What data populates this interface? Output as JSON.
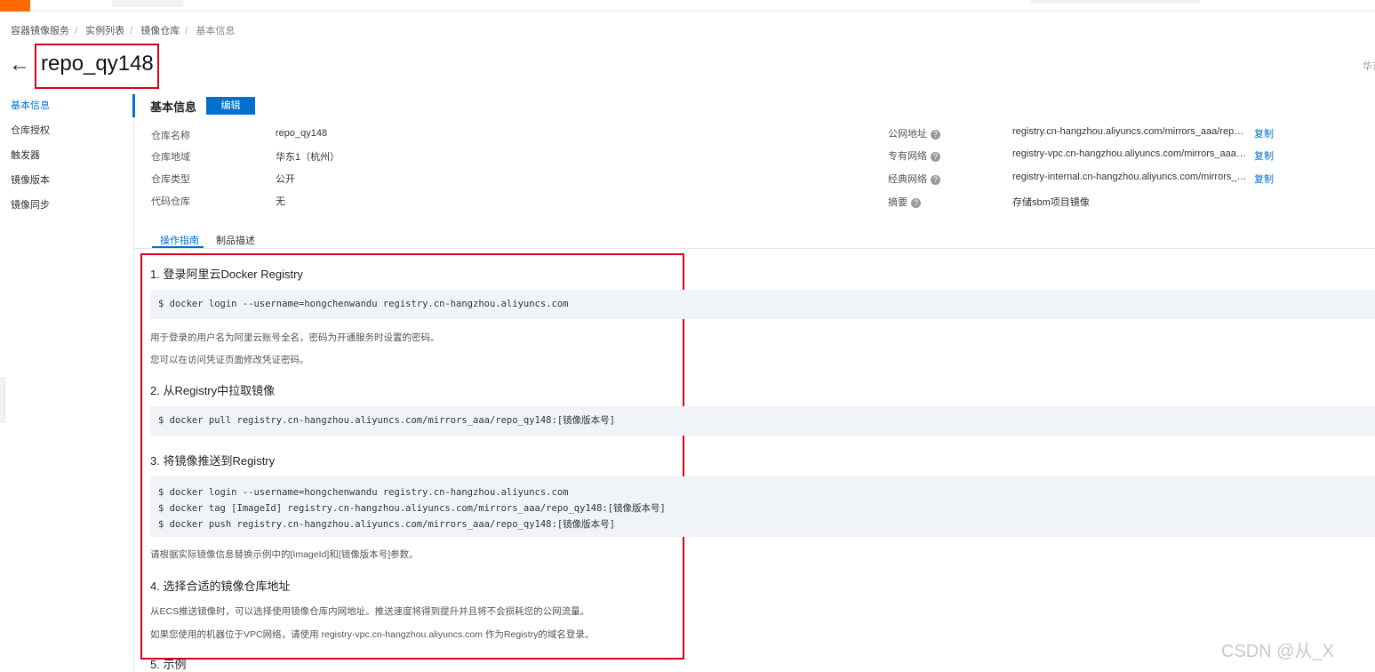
{
  "breadcrumb": [
    "容器镜像服务",
    "实例列表",
    "镜像仓库",
    "基本信息"
  ],
  "page_title": "repo_qy148",
  "right_edge_text": "华东",
  "sidebar": {
    "items": [
      {
        "label": "基本信息",
        "active": true
      },
      {
        "label": "仓库授权"
      },
      {
        "label": "触发器"
      },
      {
        "label": "镜像版本"
      },
      {
        "label": "镜像同步"
      }
    ]
  },
  "basic_info": {
    "title": "基本信息",
    "edit_label": "编辑",
    "rows": [
      {
        "label": "仓库名称",
        "value": "repo_qy148"
      },
      {
        "label": "仓库地域",
        "value": "华东1（杭州）"
      },
      {
        "label": "仓库类型",
        "value": "公开"
      },
      {
        "label": "代码仓库",
        "value": "无"
      }
    ],
    "addresses": [
      {
        "label": "公网地址",
        "value": "registry.cn-hangzhou.aliyuncs.com/mirrors_aaa/repo_q...",
        "copy": "复制"
      },
      {
        "label": "专有网络",
        "value": "registry-vpc.cn-hangzhou.aliyuncs.com/mirrors_aaa/re...",
        "copy": "复制"
      },
      {
        "label": "经典网络",
        "value": "registry-internal.cn-hangzhou.aliyuncs.com/mirrors_aa...",
        "copy": "复制"
      },
      {
        "label": "摘要",
        "value": "存储sbm项目镜像"
      }
    ]
  },
  "tabs": [
    {
      "label": "操作指南",
      "active": true
    },
    {
      "label": "制品描述"
    }
  ],
  "guide": {
    "s1_title": "1. 登录阿里云Docker Registry",
    "s1_code": "$ docker login --username=hongchenwandu registry.cn-hangzhou.aliyuncs.com",
    "s1_note1": "用于登录的用户名为阿里云账号全名，密码为开通服务时设置的密码。",
    "s1_note2": "您可以在访问凭证页面修改凭证密码。",
    "s2_title": "2. 从Registry中拉取镜像",
    "s2_code": "$ docker pull registry.cn-hangzhou.aliyuncs.com/mirrors_aaa/repo_qy148:[镜像版本号]",
    "s3_title": "3. 将镜像推送到Registry",
    "s3_code1": "$ docker login --username=hongchenwandu registry.cn-hangzhou.aliyuncs.com",
    "s3_code2": "$ docker tag [ImageId] registry.cn-hangzhou.aliyuncs.com/mirrors_aaa/repo_qy148:[镜像版本号]",
    "s3_code3": "$ docker push registry.cn-hangzhou.aliyuncs.com/mirrors_aaa/repo_qy148:[镜像版本号]",
    "s3_note": "请根据实际镜像信息替换示例中的[ImageId]和[镜像版本号]参数。",
    "s4_title": "4. 选择合适的镜像仓库地址",
    "s4_note1": "从ECS推送镜像时，可以选择使用镜像仓库内网地址。推送速度将得到提升并且将不会损耗您的公网流量。",
    "s4_note2": "如果您使用的机器位于VPC网络，请使用 registry-vpc.cn-hangzhou.aliyuncs.com 作为Registry的域名登录。",
    "s5_title": "5. 示例"
  },
  "watermark": "CSDN @从_X"
}
